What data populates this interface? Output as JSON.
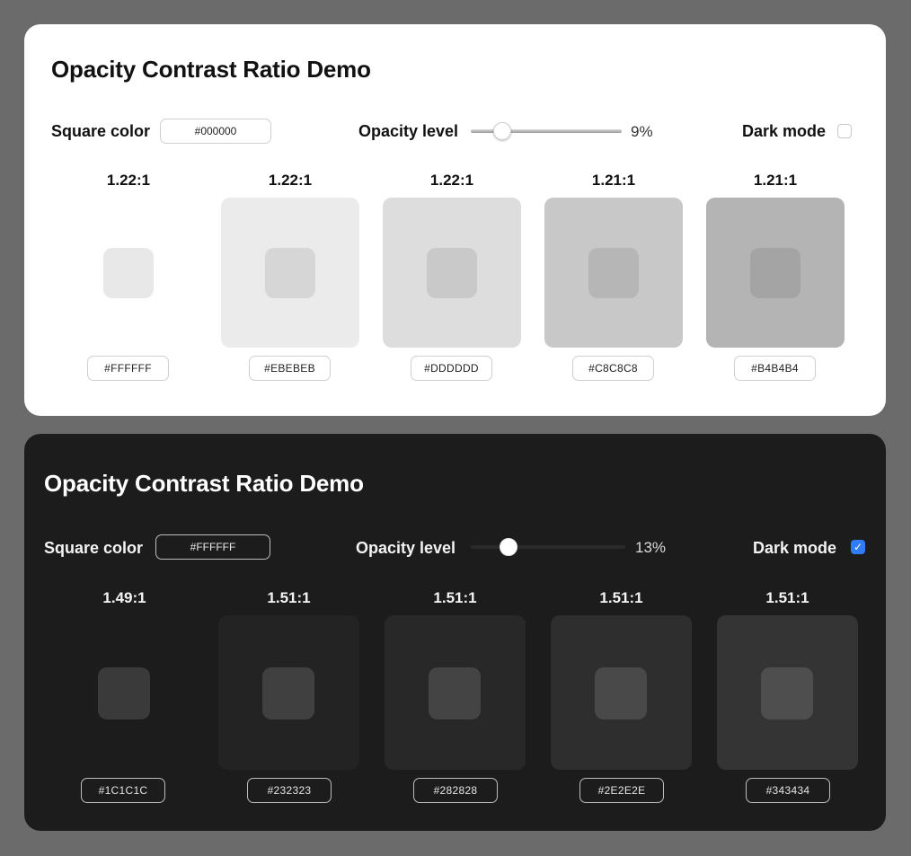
{
  "light_panel": {
    "title": "Opacity Contrast Ratio Demo",
    "square_color_label": "Square color",
    "square_color_value": "#000000",
    "opacity_label": "Opacity level",
    "opacity_value_text": "9%",
    "opacity_fraction": 0.09,
    "dark_mode_label": "Dark mode",
    "dark_mode_checked": false,
    "swatches": [
      {
        "ratio": "1.22:1",
        "hex": "#FFFFFF",
        "bg": "#FFFFFF",
        "inner": "#E8E8E8"
      },
      {
        "ratio": "1.22:1",
        "hex": "#EBEBEB",
        "bg": "#EBEBEB",
        "inner": "#D6D6D6"
      },
      {
        "ratio": "1.22:1",
        "hex": "#DDDDDD",
        "bg": "#DDDDDD",
        "inner": "#C9C9C9"
      },
      {
        "ratio": "1.21:1",
        "hex": "#C8C8C8",
        "bg": "#C8C8C8",
        "inner": "#B6B6B6"
      },
      {
        "ratio": "1.21:1",
        "hex": "#B4B4B4",
        "bg": "#B4B4B4",
        "inner": "#A4A4A4"
      }
    ]
  },
  "dark_panel": {
    "title": "Opacity Contrast Ratio Demo",
    "square_color_label": "Square color",
    "square_color_value": "#FFFFFF",
    "opacity_label": "Opacity level",
    "opacity_value_text": "13%",
    "opacity_fraction": 0.13,
    "dark_mode_label": "Dark mode",
    "dark_mode_checked": true,
    "checkmark": "✓",
    "swatches": [
      {
        "ratio": "1.49:1",
        "hex": "#1C1C1C",
        "bg": "#1C1C1C",
        "inner": "#3A3A3A"
      },
      {
        "ratio": "1.51:1",
        "hex": "#232323",
        "bg": "#232323",
        "inner": "#404040"
      },
      {
        "ratio": "1.51:1",
        "hex": "#282828",
        "bg": "#282828",
        "inner": "#444444"
      },
      {
        "ratio": "1.51:1",
        "hex": "#2E2E2E",
        "bg": "#2E2E2E",
        "inner": "#494949"
      },
      {
        "ratio": "1.51:1",
        "hex": "#343434",
        "bg": "#343434",
        "inner": "#4E4E4E"
      }
    ]
  }
}
